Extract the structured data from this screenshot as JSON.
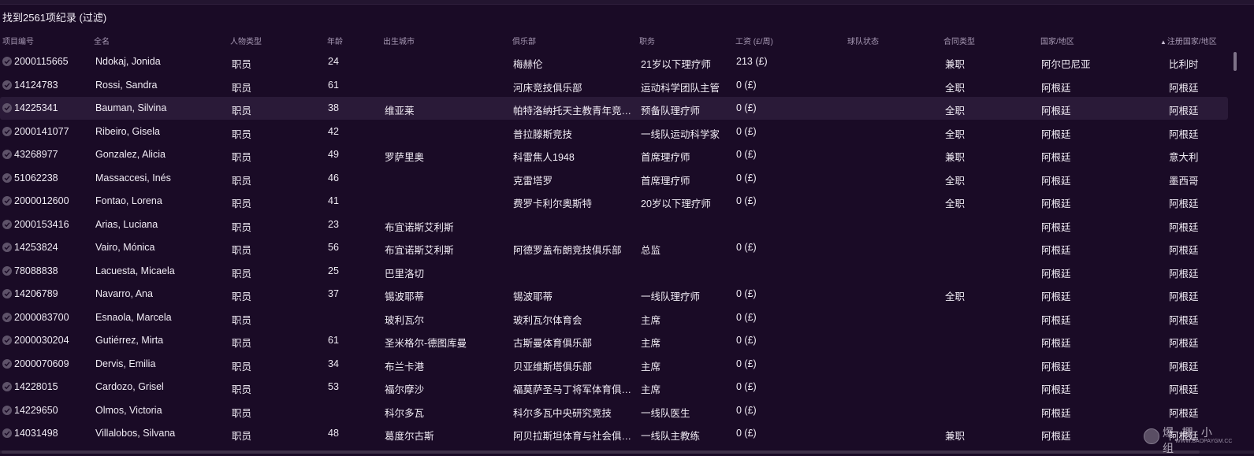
{
  "results_label": "找到2561项纪录 (过滤)",
  "columns": [
    {
      "key": "id",
      "label": "项目编号"
    },
    {
      "key": "name",
      "label": "全名"
    },
    {
      "key": "type",
      "label": "人物类型"
    },
    {
      "key": "age",
      "label": "年龄"
    },
    {
      "key": "city",
      "label": "出生城市"
    },
    {
      "key": "club",
      "label": "俱乐部"
    },
    {
      "key": "role",
      "label": "职务"
    },
    {
      "key": "wage",
      "label": "工资 (£/周)"
    },
    {
      "key": "squad_status",
      "label": "球队状态"
    },
    {
      "key": "contract",
      "label": "合同类型"
    },
    {
      "key": "nation",
      "label": "国家/地区"
    },
    {
      "key": "reg_nation",
      "label": "注册国家/地区"
    }
  ],
  "sort_arrow": "▲",
  "rows": [
    {
      "id": "2000115665",
      "name": "Ndokaj, Jonida",
      "type": "职员",
      "age": "24",
      "city": "",
      "club": "梅赫伦",
      "role": "21岁以下理疗师",
      "wage": "213 (£)",
      "squad_status": "",
      "contract": "兼职",
      "nation": "阿尔巴尼亚",
      "reg_nation": "比利时"
    },
    {
      "id": "14124783",
      "name": "Rossi, Sandra",
      "type": "职员",
      "age": "61",
      "city": "",
      "club": "河床竞技俱乐部",
      "role": "运动科学团队主管",
      "wage": "0 (£)",
      "squad_status": "",
      "contract": "全职",
      "nation": "阿根廷",
      "reg_nation": "阿根廷"
    },
    {
      "id": "14225341",
      "name": "Bauman, Silvina",
      "type": "职员",
      "age": "38",
      "city": "维亚莱",
      "club": "帕特洛纳托天主教青年竞…",
      "role": "预备队理疗师",
      "wage": "0 (£)",
      "squad_status": "",
      "contract": "全职",
      "nation": "阿根廷",
      "reg_nation": "阿根廷"
    },
    {
      "id": "2000141077",
      "name": "Ribeiro, Gisela",
      "type": "职员",
      "age": "42",
      "city": "",
      "club": "普拉滕斯竞技",
      "role": "一线队运动科学家",
      "wage": "0 (£)",
      "squad_status": "",
      "contract": "全职",
      "nation": "阿根廷",
      "reg_nation": "阿根廷"
    },
    {
      "id": "43268977",
      "name": "Gonzalez, Alicia",
      "type": "职员",
      "age": "49",
      "city": "罗萨里奥",
      "club": "科雷焦人1948",
      "role": "首席理疗师",
      "wage": "0 (£)",
      "squad_status": "",
      "contract": "兼职",
      "nation": "阿根廷",
      "reg_nation": "意大利"
    },
    {
      "id": "51062238",
      "name": "Massaccesi, Inés",
      "type": "职员",
      "age": "46",
      "city": "",
      "club": "克雷塔罗",
      "role": "首席理疗师",
      "wage": "0 (£)",
      "squad_status": "",
      "contract": "全职",
      "nation": "阿根廷",
      "reg_nation": "墨西哥"
    },
    {
      "id": "2000012600",
      "name": "Fontao, Lorena",
      "type": "职员",
      "age": "41",
      "city": "",
      "club": "费罗卡利尔奥斯特",
      "role": "20岁以下理疗师",
      "wage": "0 (£)",
      "squad_status": "",
      "contract": "全职",
      "nation": "阿根廷",
      "reg_nation": "阿根廷"
    },
    {
      "id": "2000153416",
      "name": "Arias, Luciana",
      "type": "职员",
      "age": "23",
      "city": "布宜诺斯艾利斯",
      "club": "",
      "role": "",
      "wage": "",
      "squad_status": "",
      "contract": "",
      "nation": "阿根廷",
      "reg_nation": "阿根廷"
    },
    {
      "id": "14253824",
      "name": "Vairo, Mónica",
      "type": "职员",
      "age": "56",
      "city": "布宜诺斯艾利斯",
      "club": "阿德罗盖布朗竞技俱乐部",
      "role": "总监",
      "wage": "0 (£)",
      "squad_status": "",
      "contract": "",
      "nation": "阿根廷",
      "reg_nation": "阿根廷"
    },
    {
      "id": "78088838",
      "name": "Lacuesta, Micaela",
      "type": "职员",
      "age": "25",
      "city": "巴里洛切",
      "club": "",
      "role": "",
      "wage": "",
      "squad_status": "",
      "contract": "",
      "nation": "阿根廷",
      "reg_nation": "阿根廷"
    },
    {
      "id": "14206789",
      "name": "Navarro, Ana",
      "type": "职员",
      "age": "37",
      "city": "锡波耶蒂",
      "club": "锡波耶蒂",
      "role": "一线队理疗师",
      "wage": "0 (£)",
      "squad_status": "",
      "contract": "全职",
      "nation": "阿根廷",
      "reg_nation": "阿根廷"
    },
    {
      "id": "2000083700",
      "name": "Esnaola, Marcela",
      "type": "职员",
      "age": "",
      "city": "玻利瓦尔",
      "club": "玻利瓦尔体育会",
      "role": "主席",
      "wage": "0 (£)",
      "squad_status": "",
      "contract": "",
      "nation": "阿根廷",
      "reg_nation": "阿根廷"
    },
    {
      "id": "2000030204",
      "name": "Gutiérrez, Mirta",
      "type": "职员",
      "age": "61",
      "city": "圣米格尔-德图库曼",
      "club": "古斯曼体育俱乐部",
      "role": "主席",
      "wage": "0 (£)",
      "squad_status": "",
      "contract": "",
      "nation": "阿根廷",
      "reg_nation": "阿根廷"
    },
    {
      "id": "2000070609",
      "name": "Dervis, Emilia",
      "type": "职员",
      "age": "34",
      "city": "布兰卡港",
      "club": "贝亚维斯塔俱乐部",
      "role": "主席",
      "wage": "0 (£)",
      "squad_status": "",
      "contract": "",
      "nation": "阿根廷",
      "reg_nation": "阿根廷"
    },
    {
      "id": "14228015",
      "name": "Cardozo, Grisel",
      "type": "职员",
      "age": "53",
      "city": "福尔摩沙",
      "club": "福莫萨圣马丁将军体育俱…",
      "role": "主席",
      "wage": "0 (£)",
      "squad_status": "",
      "contract": "",
      "nation": "阿根廷",
      "reg_nation": "阿根廷"
    },
    {
      "id": "14229650",
      "name": "Olmos, Victoria",
      "type": "职员",
      "age": "",
      "city": "科尔多瓦",
      "club": "科尔多瓦中央研究竞技",
      "role": "一线队医生",
      "wage": "0 (£)",
      "squad_status": "",
      "contract": "",
      "nation": "阿根廷",
      "reg_nation": "阿根廷"
    },
    {
      "id": "14031498",
      "name": "Villalobos, Silvana",
      "type": "职员",
      "age": "48",
      "city": "葛度尔古斯",
      "club": "阿贝拉斯坦体育与社会俱…",
      "role": "一线队主教练",
      "wage": "0 (£)",
      "squad_status": "",
      "contract": "兼职",
      "nation": "阿根廷",
      "reg_nation": "阿根廷"
    }
  ],
  "watermark": {
    "text": "爆 棚 小 组",
    "url": "WWW.BAOPAYGM.CC"
  },
  "colors": {
    "background": "#1a0b26",
    "row_hover": "#2a1a38",
    "header_text": "#a597b2",
    "body_text": "#f1ecf5"
  }
}
